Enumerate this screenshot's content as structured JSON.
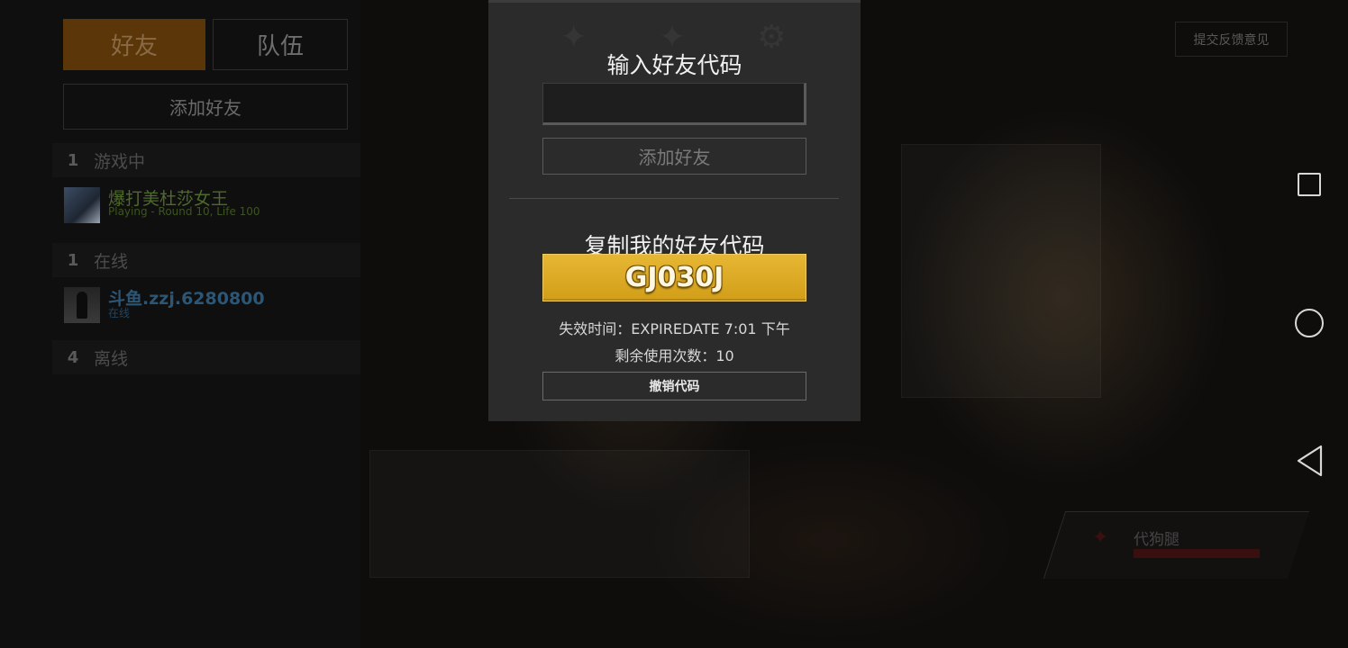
{
  "tabs": {
    "friends": "好友",
    "team": "队伍"
  },
  "sidebar": {
    "add_friend": "添加好友",
    "groups": [
      {
        "count": "1",
        "label": "游戏中"
      },
      {
        "count": "1",
        "label": "在线"
      },
      {
        "count": "4",
        "label": "离线"
      }
    ],
    "friends": [
      {
        "name": "爆打美杜莎女王",
        "status": "Playing - Round 10, Life 100"
      },
      {
        "name": "斗鱼.zzj.6280800",
        "status": "在线"
      }
    ]
  },
  "feedback_button": "提交反馈意见",
  "character_card": {
    "name": "代狗腿"
  },
  "modal": {
    "enter_title": "输入好友代码",
    "input_value": "",
    "add_button": "添加好友",
    "copy_title": "复制我的好友代码",
    "friend_code": "GJ030J",
    "expire_label": "失效时间：EXPIREDATE 7:01 下午",
    "uses_label": "剩余使用次数：10",
    "revoke_button": "撤销代码"
  },
  "icons": {
    "nav_recents": "square-icon",
    "nav_home": "circle-icon",
    "nav_back": "triangle-back-icon"
  },
  "colors": {
    "accent_gold": "#e0ae2a",
    "friends_tab": "#5a3608"
  }
}
